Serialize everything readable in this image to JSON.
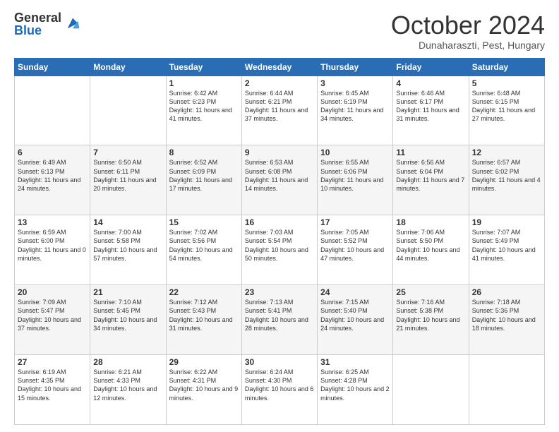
{
  "header": {
    "logo_general": "General",
    "logo_blue": "Blue",
    "month": "October 2024",
    "location": "Dunaharaszti, Pest, Hungary"
  },
  "days_of_week": [
    "Sunday",
    "Monday",
    "Tuesday",
    "Wednesday",
    "Thursday",
    "Friday",
    "Saturday"
  ],
  "weeks": [
    [
      {
        "day": "",
        "info": ""
      },
      {
        "day": "",
        "info": ""
      },
      {
        "day": "1",
        "info": "Sunrise: 6:42 AM\nSunset: 6:23 PM\nDaylight: 11 hours and 41 minutes."
      },
      {
        "day": "2",
        "info": "Sunrise: 6:44 AM\nSunset: 6:21 PM\nDaylight: 11 hours and 37 minutes."
      },
      {
        "day": "3",
        "info": "Sunrise: 6:45 AM\nSunset: 6:19 PM\nDaylight: 11 hours and 34 minutes."
      },
      {
        "day": "4",
        "info": "Sunrise: 6:46 AM\nSunset: 6:17 PM\nDaylight: 11 hours and 31 minutes."
      },
      {
        "day": "5",
        "info": "Sunrise: 6:48 AM\nSunset: 6:15 PM\nDaylight: 11 hours and 27 minutes."
      }
    ],
    [
      {
        "day": "6",
        "info": "Sunrise: 6:49 AM\nSunset: 6:13 PM\nDaylight: 11 hours and 24 minutes."
      },
      {
        "day": "7",
        "info": "Sunrise: 6:50 AM\nSunset: 6:11 PM\nDaylight: 11 hours and 20 minutes."
      },
      {
        "day": "8",
        "info": "Sunrise: 6:52 AM\nSunset: 6:09 PM\nDaylight: 11 hours and 17 minutes."
      },
      {
        "day": "9",
        "info": "Sunrise: 6:53 AM\nSunset: 6:08 PM\nDaylight: 11 hours and 14 minutes."
      },
      {
        "day": "10",
        "info": "Sunrise: 6:55 AM\nSunset: 6:06 PM\nDaylight: 11 hours and 10 minutes."
      },
      {
        "day": "11",
        "info": "Sunrise: 6:56 AM\nSunset: 6:04 PM\nDaylight: 11 hours and 7 minutes."
      },
      {
        "day": "12",
        "info": "Sunrise: 6:57 AM\nSunset: 6:02 PM\nDaylight: 11 hours and 4 minutes."
      }
    ],
    [
      {
        "day": "13",
        "info": "Sunrise: 6:59 AM\nSunset: 6:00 PM\nDaylight: 11 hours and 0 minutes."
      },
      {
        "day": "14",
        "info": "Sunrise: 7:00 AM\nSunset: 5:58 PM\nDaylight: 10 hours and 57 minutes."
      },
      {
        "day": "15",
        "info": "Sunrise: 7:02 AM\nSunset: 5:56 PM\nDaylight: 10 hours and 54 minutes."
      },
      {
        "day": "16",
        "info": "Sunrise: 7:03 AM\nSunset: 5:54 PM\nDaylight: 10 hours and 50 minutes."
      },
      {
        "day": "17",
        "info": "Sunrise: 7:05 AM\nSunset: 5:52 PM\nDaylight: 10 hours and 47 minutes."
      },
      {
        "day": "18",
        "info": "Sunrise: 7:06 AM\nSunset: 5:50 PM\nDaylight: 10 hours and 44 minutes."
      },
      {
        "day": "19",
        "info": "Sunrise: 7:07 AM\nSunset: 5:49 PM\nDaylight: 10 hours and 41 minutes."
      }
    ],
    [
      {
        "day": "20",
        "info": "Sunrise: 7:09 AM\nSunset: 5:47 PM\nDaylight: 10 hours and 37 minutes."
      },
      {
        "day": "21",
        "info": "Sunrise: 7:10 AM\nSunset: 5:45 PM\nDaylight: 10 hours and 34 minutes."
      },
      {
        "day": "22",
        "info": "Sunrise: 7:12 AM\nSunset: 5:43 PM\nDaylight: 10 hours and 31 minutes."
      },
      {
        "day": "23",
        "info": "Sunrise: 7:13 AM\nSunset: 5:41 PM\nDaylight: 10 hours and 28 minutes."
      },
      {
        "day": "24",
        "info": "Sunrise: 7:15 AM\nSunset: 5:40 PM\nDaylight: 10 hours and 24 minutes."
      },
      {
        "day": "25",
        "info": "Sunrise: 7:16 AM\nSunset: 5:38 PM\nDaylight: 10 hours and 21 minutes."
      },
      {
        "day": "26",
        "info": "Sunrise: 7:18 AM\nSunset: 5:36 PM\nDaylight: 10 hours and 18 minutes."
      }
    ],
    [
      {
        "day": "27",
        "info": "Sunrise: 6:19 AM\nSunset: 4:35 PM\nDaylight: 10 hours and 15 minutes."
      },
      {
        "day": "28",
        "info": "Sunrise: 6:21 AM\nSunset: 4:33 PM\nDaylight: 10 hours and 12 minutes."
      },
      {
        "day": "29",
        "info": "Sunrise: 6:22 AM\nSunset: 4:31 PM\nDaylight: 10 hours and 9 minutes."
      },
      {
        "day": "30",
        "info": "Sunrise: 6:24 AM\nSunset: 4:30 PM\nDaylight: 10 hours and 6 minutes."
      },
      {
        "day": "31",
        "info": "Sunrise: 6:25 AM\nSunset: 4:28 PM\nDaylight: 10 hours and 2 minutes."
      },
      {
        "day": "",
        "info": ""
      },
      {
        "day": "",
        "info": ""
      }
    ]
  ]
}
